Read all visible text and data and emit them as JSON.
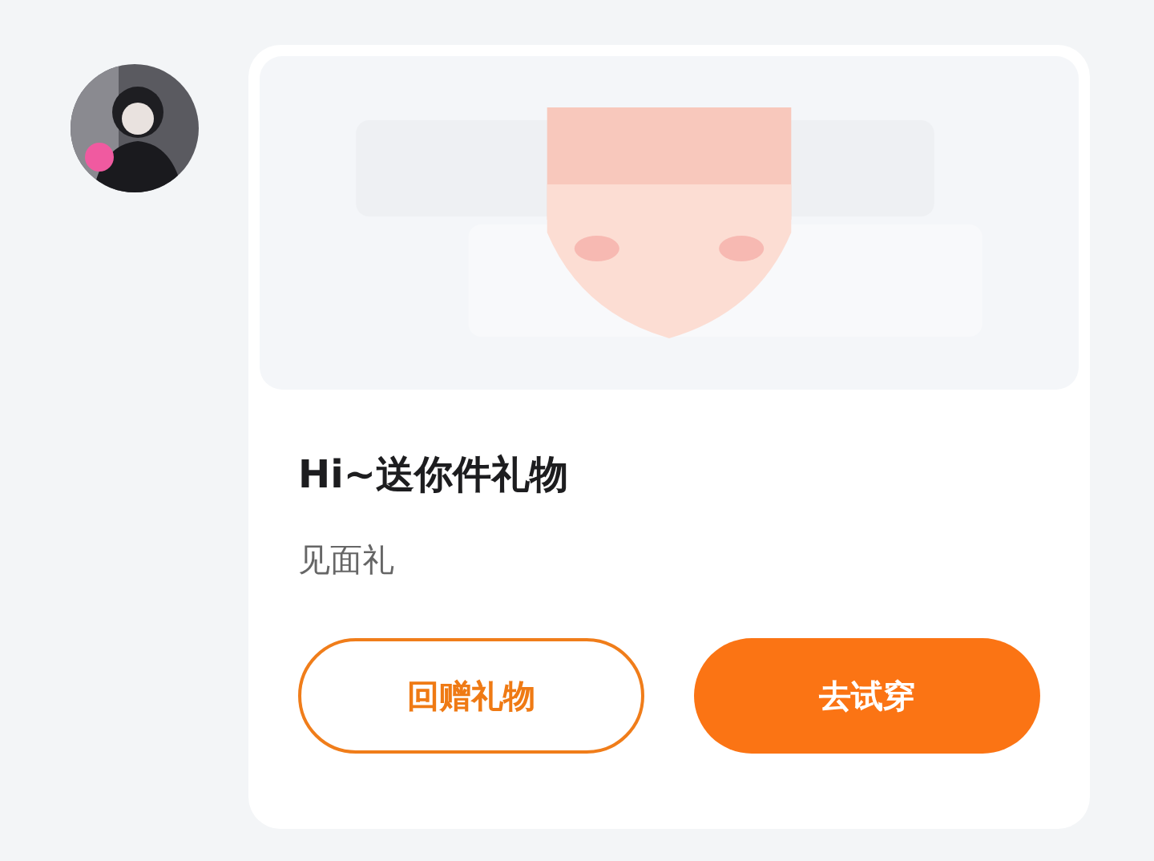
{
  "message": {
    "card": {
      "title": "Hi~送你件礼物",
      "subtitle": "见面礼",
      "buttons": [
        {
          "label": "回赠礼物",
          "kind": "outline"
        },
        {
          "label": "去试穿",
          "kind": "filled"
        }
      ]
    }
  }
}
